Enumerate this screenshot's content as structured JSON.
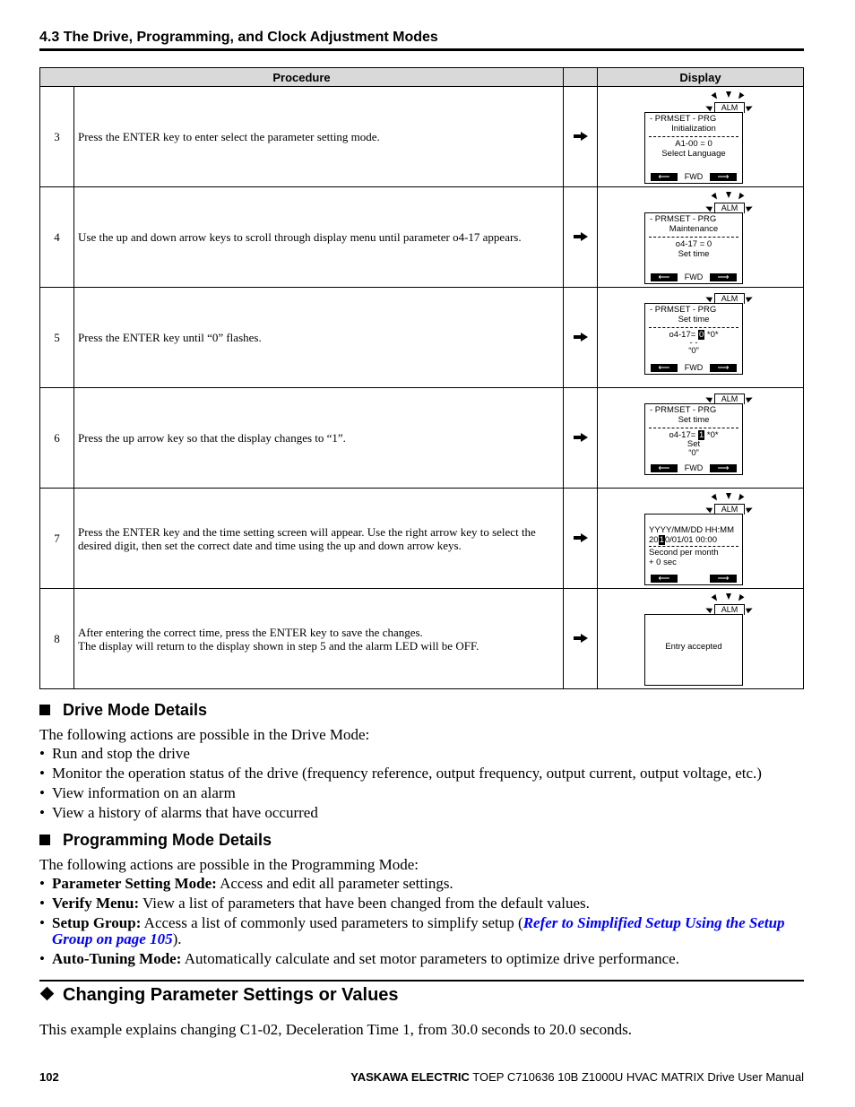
{
  "header": {
    "section_title": "4.3 The Drive, Programming, and Clock Adjustment Modes"
  },
  "table": {
    "col_procedure": "Procedure",
    "col_display": "Display",
    "steps": [
      {
        "num": "3",
        "text": "Press the ENTER key to enter select the parameter setting mode.",
        "display": {
          "alm": "ALM",
          "line1": "- PRMSET -   PRG",
          "line2": "Initialization",
          "line3": "A1-00 = 0",
          "line4": "Select Language",
          "fwd": "FWD"
        }
      },
      {
        "num": "4",
        "text": "Use the up and down arrow keys to scroll through display menu until parameter o4-17 appears.",
        "display": {
          "alm": "ALM",
          "line1": "- PRMSET -   PRG",
          "line2": "Maintenance",
          "line3": "o4-17 = 0",
          "line4": "Set time",
          "fwd": "FWD"
        }
      },
      {
        "num": "5",
        "text": "Press the ENTER key until “0” flashes.",
        "display": {
          "alm": "ALM",
          "line1": "- PRMSET -   PRG",
          "line2": "Set time",
          "line3_prefix": "o4-17=",
          "line3_value": "0",
          "line3_suffix": "*0*",
          "line4": "- -",
          "line5": "“0”",
          "fwd": "FWD"
        }
      },
      {
        "num": "6",
        "text": "Press the up arrow key so that the display changes to “1”.",
        "display": {
          "alm": "ALM",
          "line1": "- PRMSET -   PRG",
          "line2": "Set time",
          "line3_prefix": "o4-17=",
          "line3_value": "1",
          "line3_suffix": "*0*",
          "line4": "Set",
          "line5": "“0”",
          "fwd": "FWD"
        }
      },
      {
        "num": "7",
        "text": "Press the ENTER key and the time setting screen will appear. Use the right arrow key to select the desired digit, then set the correct date and time using the up and down arrow keys.",
        "display": {
          "alm": "ALM",
          "line1": "YYYY/MM/DD  HH:MM",
          "line2_prefix": "20",
          "line2_value": "1",
          "line2_suffix": "0/01/01  00:00",
          "line3": "Second per month",
          "line4": "+ 0 sec"
        }
      },
      {
        "num": "8",
        "text_line1": "After entering the correct time, press the ENTER key to save the changes.",
        "text_line2": "The display will return to the display shown in step 5 and the alarm LED will be OFF.",
        "display": {
          "alm": "ALM",
          "message": "Entry accepted"
        }
      }
    ]
  },
  "drive_mode": {
    "title": "Drive Mode Details",
    "intro": "The following actions are possible in the Drive Mode:",
    "items": [
      "Run and stop the drive",
      "Monitor the operation status of the drive (frequency reference, output frequency, output current, output voltage, etc.)",
      "View information on an alarm",
      "View a history of alarms that have occurred"
    ]
  },
  "programming_mode": {
    "title": "Programming Mode Details",
    "intro": "The following actions are possible in the Programming Mode:",
    "items": [
      {
        "bold": "Parameter Setting Mode:",
        "text": " Access and edit all parameter settings."
      },
      {
        "bold": "Verify Menu:",
        "text": " View a list of parameters that have been changed from the default values."
      },
      {
        "bold": "Setup Group:",
        "text": " Access a list of commonly used parameters to simplify setup (",
        "link": "Refer to Simplified Setup Using the Setup Group on page 105",
        "after": ")."
      },
      {
        "bold": "Auto-Tuning Mode:",
        "text": " Automatically calculate and set motor parameters to optimize drive performance."
      }
    ],
    "link_color": "#0000ff"
  },
  "changing": {
    "title": "Changing Parameter Settings or Values",
    "text": "This example explains changing C1-02, Deceleration Time 1, from 30.0 seconds to 20.0 seconds."
  },
  "footer": {
    "page_number": "102",
    "brand": "YASKAWA ELECTRIC",
    "doc": " TOEP C710636 10B Z1000U HVAC MATRIX Drive User Manual"
  }
}
